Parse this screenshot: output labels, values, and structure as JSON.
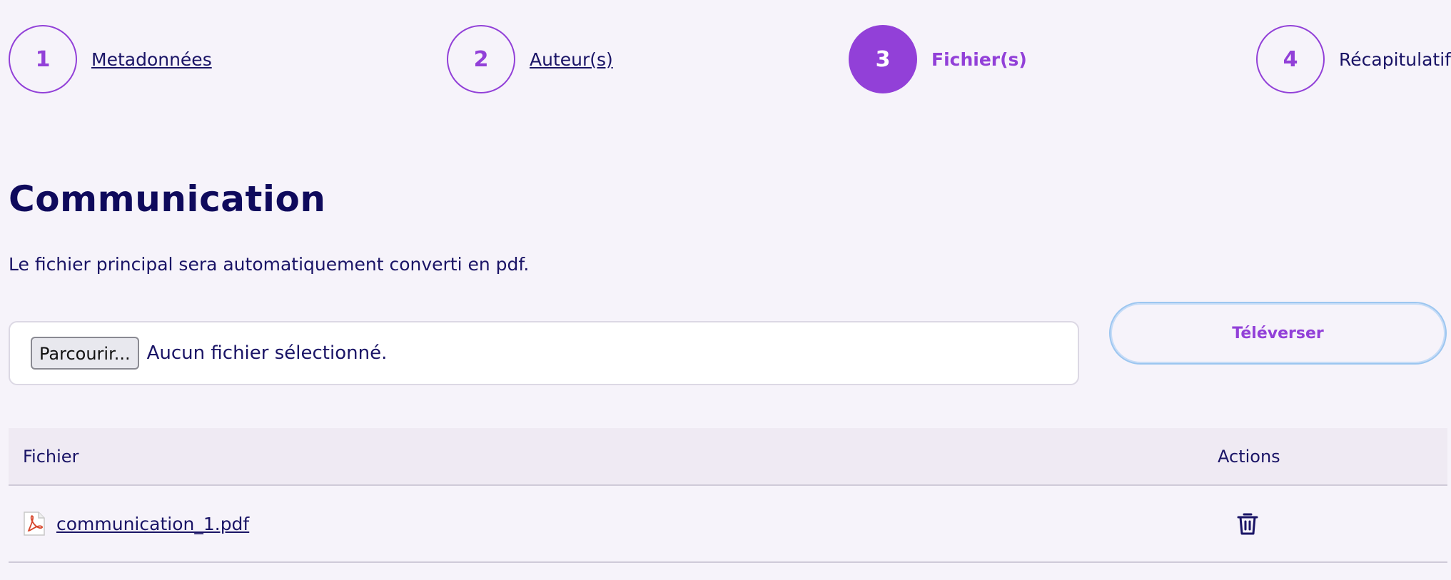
{
  "stepper": {
    "steps": [
      {
        "number": "1",
        "label": "Metadonnées"
      },
      {
        "number": "2",
        "label": "Auteur(s)"
      },
      {
        "number": "3",
        "label": "Fichier(s)"
      },
      {
        "number": "4",
        "label": "Récapitulatif"
      }
    ],
    "active_step": 3
  },
  "main": {
    "title": "Communication",
    "subtitle": "Le fichier principal sera automatiquement converti en pdf."
  },
  "file_input": {
    "browse_label": "Parcourir...",
    "status": "Aucun fichier sélectionné."
  },
  "upload_button": {
    "label": "Téléverser"
  },
  "table": {
    "headers": {
      "file": "Fichier",
      "actions": "Actions"
    },
    "rows": [
      {
        "file_name": "communication_1.pdf",
        "file_icon": "pdf-icon",
        "action_icon": "trash-icon"
      }
    ]
  },
  "colors": {
    "accent": "#9240d8",
    "text": "#1a1466",
    "background": "#f6f3fa"
  }
}
